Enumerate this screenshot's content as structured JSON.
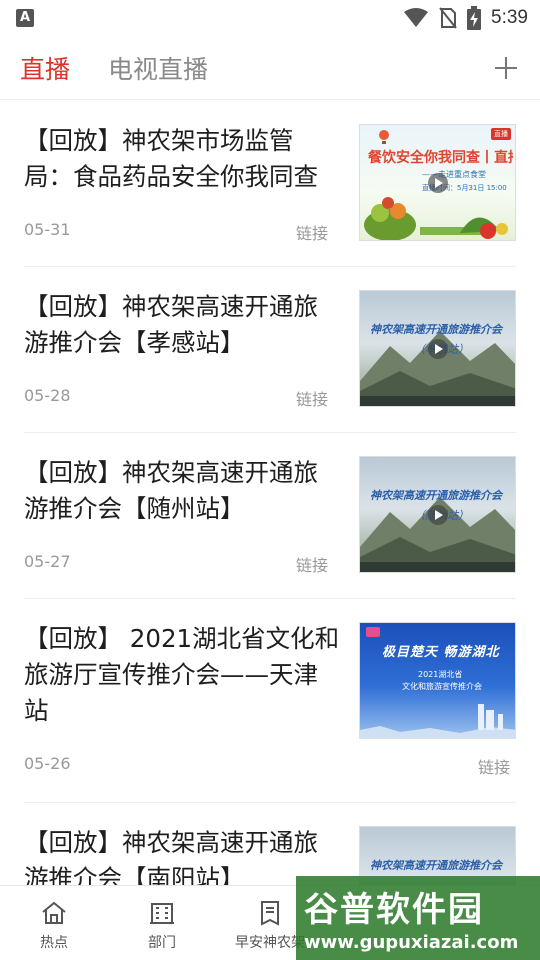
{
  "status_bar": {
    "app_badge": "A",
    "time": "5:39"
  },
  "header": {
    "tabs": [
      {
        "label": "直播",
        "active": true
      },
      {
        "label": "电视直播",
        "active": false
      }
    ]
  },
  "feed": {
    "items": [
      {
        "title": "【回放】神农架市场监管局：食品药品安全你我同查",
        "date": "05-31",
        "source": "链接",
        "thumbnail": {
          "headline": "餐饮安全你我同查丨直播",
          "subline": "——走进重点食堂",
          "date_line": "直播时间：5月31日 15:00",
          "badge": "直播"
        }
      },
      {
        "title": "【回放】神农架高速开通旅游推介会【孝感站】",
        "date": "05-28",
        "source": "链接",
        "thumbnail": {
          "headline": "神农架高速开通旅游推介会",
          "subline": "（孝感站）"
        }
      },
      {
        "title": "【回放】神农架高速开通旅游推介会【随州站】",
        "date": "05-27",
        "source": "链接",
        "thumbnail": {
          "headline": "神农架高速开通旅游推介会",
          "subline": "（随州站）"
        }
      },
      {
        "title": "【回放】 2021湖北省文化和旅游厅宣传推介会——天津站",
        "date": "05-26",
        "source": "链接",
        "thumbnail": {
          "headline": "极目楚天 畅游湖北",
          "subline": "2021湖北省",
          "date_line": "文化和旅游宣传推介会"
        }
      },
      {
        "title": "【回放】神农架高速开通旅游推介会【南阳站】",
        "date": "",
        "source": "",
        "thumbnail": {
          "headline": "神农架高速开通旅游推介会",
          "subline": ""
        }
      }
    ]
  },
  "bottom_nav": {
    "items": [
      {
        "label": "热点",
        "icon": "home-icon"
      },
      {
        "label": "部门",
        "icon": "building-icon"
      },
      {
        "label": "早安神农架",
        "icon": "document-icon"
      }
    ]
  },
  "watermark": {
    "title": "谷普软件园",
    "url": "www.gupuxiazai.com"
  },
  "colors": {
    "accent": "#d9352b",
    "muted": "#999999",
    "divider": "#eeeeee"
  }
}
